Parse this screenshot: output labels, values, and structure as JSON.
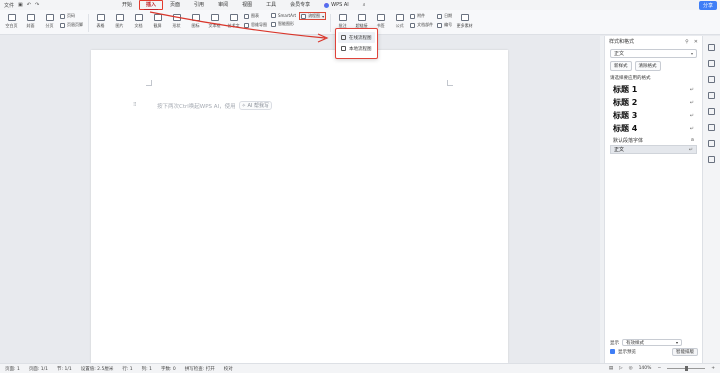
{
  "menubar": {
    "file": "文件",
    "tabs": [
      "开始",
      "插入",
      "页面",
      "引用",
      "审阅",
      "视图",
      "工具",
      "会员专享"
    ],
    "wps_ai": "WPS AI",
    "share": "分享"
  },
  "ribbon": {
    "row1": [
      {
        "label": "空白页"
      },
      {
        "label": "封面"
      },
      {
        "label": "分页"
      }
    ],
    "page_break": "页码",
    "header_footer": "页眉页脚",
    "insert_items": [
      "表格",
      "图片",
      "文档",
      "截屏",
      "形状",
      "图标",
      "文本框",
      "艺术字",
      "批注",
      "超链接",
      "书签",
      "公式",
      "更多素材"
    ],
    "chart": "图表",
    "smartart": "SmartArt",
    "flowchart": "流程图",
    "mindmap": "思维导图",
    "smart_shape": "智能图形",
    "cross_ref": "交叉引用",
    "text_parts": "文档部件",
    "attachment": "附件",
    "date": "日期",
    "symbol": "符号",
    "number": "编号"
  },
  "dropdown": {
    "items": [
      "在线流程图",
      "本地流程图"
    ]
  },
  "document": {
    "hint": "按下两次Ctrl唤起WPS AI，使用",
    "ai_chip": "AI 帮我写",
    "drag": "⠿"
  },
  "pane": {
    "title": "样式和格式",
    "current_style": "正文",
    "new_style": "新样式",
    "clear_format": "清除格式",
    "apply_label": "请选择要应用的格式",
    "styles": [
      "标题 1",
      "标题 2",
      "标题 3",
      "标题 4"
    ],
    "default_font": "默认段落字体",
    "body": "正文",
    "show_label": "显示",
    "show_value": "有效样式",
    "preview": "显示预览",
    "smart_btn": "智能排版"
  },
  "status": {
    "page": "页面: 1",
    "pages": "页面: 1/1",
    "section": "节: 1/1",
    "position": "设置值: 2.5厘米",
    "line": "行: 1",
    "col": "列: 1",
    "words": "字数: 0",
    "spell": "拼写检查: 打开",
    "proof": "校对",
    "zoom": "140%"
  },
  "colors": {
    "accent": "#c0262d",
    "highlight_box": "#e23b2e",
    "share": "#3f7ef6"
  }
}
